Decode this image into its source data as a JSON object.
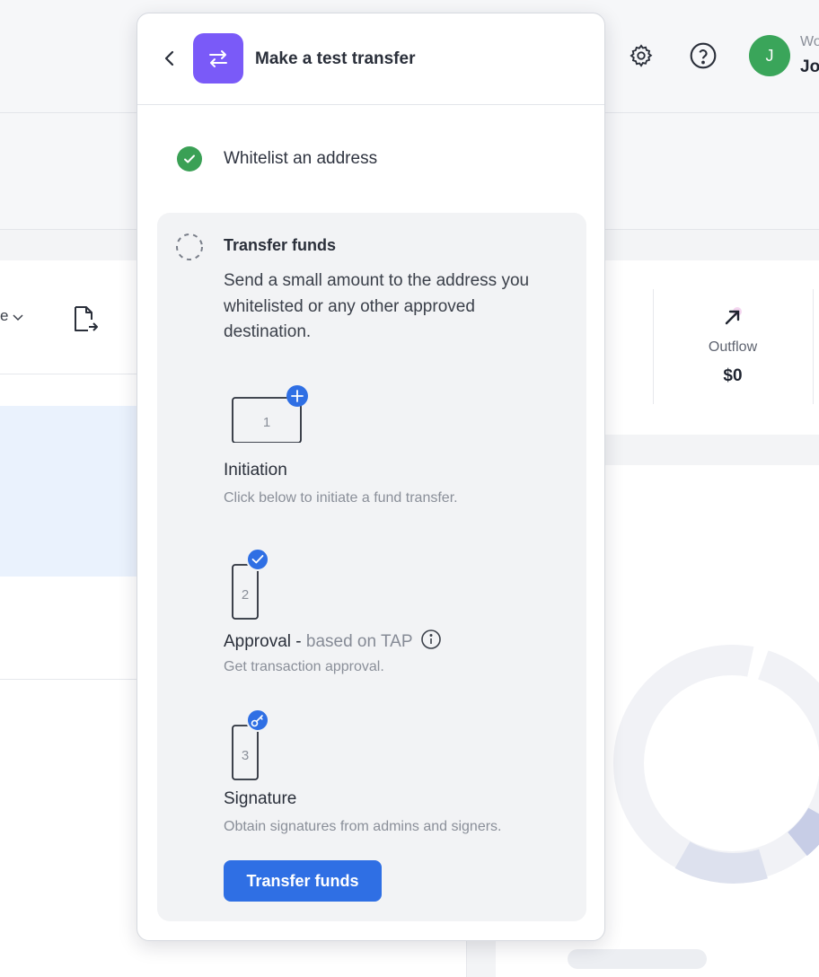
{
  "topbar": {
    "workspace_label": "Wo",
    "user_name": "Jo",
    "avatar_initial": "J",
    "icons": [
      "gear-icon",
      "help-icon"
    ]
  },
  "background": {
    "filter_text": "e",
    "outflow_label": "Outflow",
    "outflow_value": "$0"
  },
  "panel": {
    "title": "Make a test transfer",
    "header_icon": "transfer-arrows-icon",
    "step1": {
      "label": "Whitelist an address",
      "status": "completed"
    },
    "step2": {
      "title": "Transfer funds",
      "description": "Send a small amount to the address you whitelisted or any other approved destination.",
      "substeps": [
        {
          "number": "1",
          "title": "Initiation",
          "title_suffix": "",
          "description": "Click below to initiate a fund transfer.",
          "badge_icon": "plus-icon"
        },
        {
          "number": "2",
          "title": "Approval - ",
          "title_suffix": "based on TAP",
          "description": "Get transaction approval.",
          "badge_icon": "check-icon"
        },
        {
          "number": "3",
          "title": "Signature",
          "title_suffix": "",
          "description": "Obtain signatures from admins and signers.",
          "badge_icon": "key-icon"
        }
      ],
      "cta_label": "Transfer funds"
    }
  },
  "colors": {
    "accent": "#2f6fe4",
    "header_icon_bg": "#7a5af8",
    "success": "#3aa055",
    "avatar_bg": "#3aa55a"
  }
}
